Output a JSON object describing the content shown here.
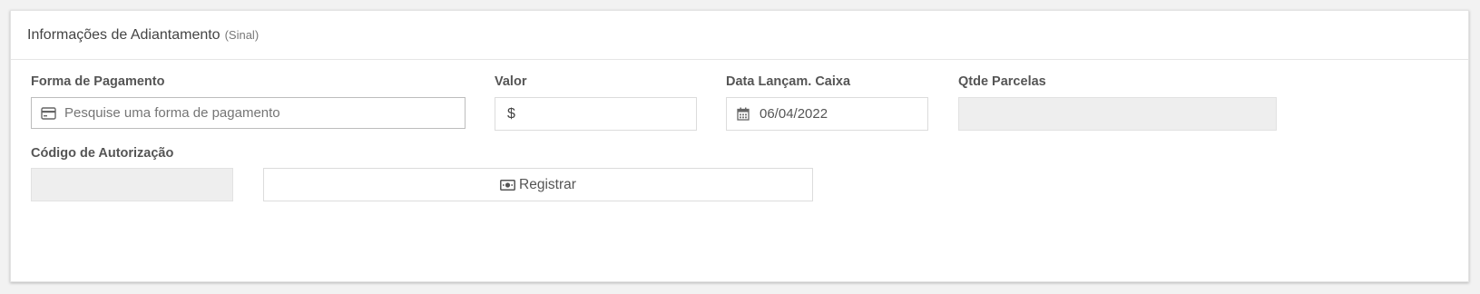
{
  "panel": {
    "title": "Informações de Adiantamento",
    "subtitle": "(Sinal)"
  },
  "fields": {
    "forma_pagamento": {
      "label": "Forma de Pagamento",
      "placeholder": "Pesquise uma forma de pagamento",
      "value": "",
      "icon": "credit-card-icon"
    },
    "valor": {
      "label": "Valor",
      "prefix": "$",
      "value": ""
    },
    "data_lancamento": {
      "label": "Data Lançam. Caixa",
      "value": "06/04/2022",
      "icon": "calendar-icon"
    },
    "qtde_parcelas": {
      "label": "Qtde Parcelas",
      "value": ""
    },
    "codigo_autorizacao": {
      "label": "Código de Autorização",
      "value": ""
    }
  },
  "actions": {
    "registrar_label": "Registrar",
    "registrar_icon": "money-bill-icon"
  }
}
